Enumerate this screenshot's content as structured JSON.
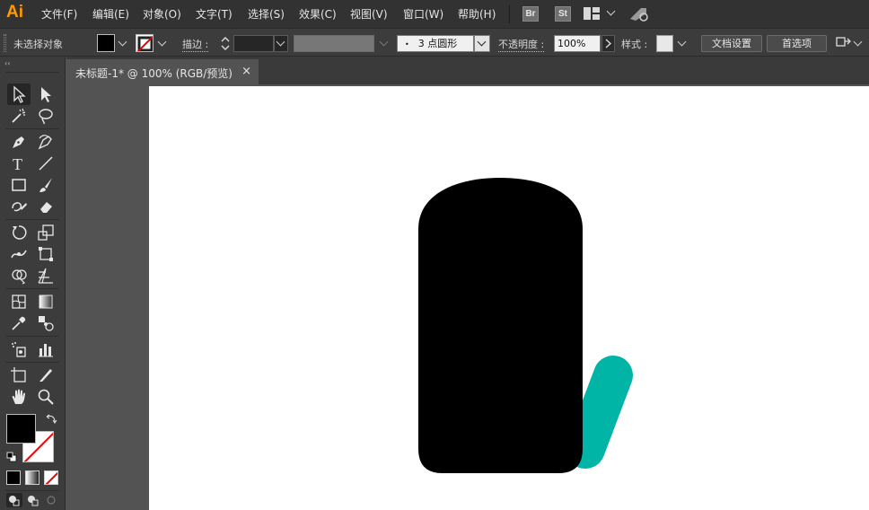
{
  "app": {
    "logo_text": "Ai"
  },
  "menu": [
    "文件(F)",
    "编辑(E)",
    "对象(O)",
    "文字(T)",
    "选择(S)",
    "效果(C)",
    "视图(V)",
    "窗口(W)",
    "帮助(H)"
  ],
  "menubar_badges": {
    "bridge": "Br",
    "stock": "St"
  },
  "control_bar": {
    "selection_status": "未选择对象",
    "stroke_label": "描边 :",
    "brush_value": "3 点圆形",
    "opacity_label": "不透明度 :",
    "opacity_value": "100%",
    "style_label": "样式 :",
    "doc_setup_button": "文档设置",
    "preferences_button": "首选项"
  },
  "document_tab": {
    "title": "未标题-1* @ 100% (RGB/预览)",
    "close_glyph": "×"
  },
  "colors": {
    "fill": "#000000",
    "accent_shape": "#00b5a6",
    "logo": "#ff9a00"
  },
  "tools": [
    "selection-tool",
    "direct-selection-tool",
    "magic-wand-tool",
    "lasso-tool",
    "pen-tool",
    "curvature-tool",
    "type-tool",
    "line-segment-tool",
    "rectangle-tool",
    "paintbrush-tool",
    "shaper-tool",
    "eraser-tool",
    "rotate-tool",
    "scale-tool",
    "width-tool",
    "free-transform-tool",
    "shape-builder-tool",
    "perspective-grid-tool",
    "mesh-tool",
    "gradient-tool",
    "eyedropper-tool",
    "blend-tool",
    "symbol-sprayer-tool",
    "column-graph-tool",
    "artboard-tool",
    "slice-tool",
    "hand-tool",
    "zoom-tool"
  ]
}
